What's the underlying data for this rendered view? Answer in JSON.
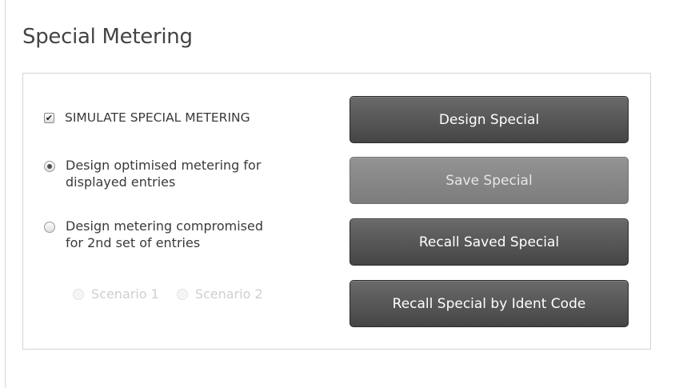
{
  "page": {
    "title": "Special Metering"
  },
  "options": {
    "simulate": {
      "label": "SIMULATE SPECIAL METERING",
      "checked": true
    },
    "optimised": {
      "line1": "Design optimised metering for",
      "line2": "displayed entries",
      "selected": true
    },
    "compromised": {
      "line1": "Design metering compromised",
      "line2": "for 2nd set of entries",
      "selected": false
    }
  },
  "scenarios": [
    {
      "label": "Scenario 1",
      "enabled": false
    },
    {
      "label": "Scenario 2",
      "enabled": false
    }
  ],
  "buttons": {
    "design": {
      "label": "Design Special",
      "enabled": true
    },
    "save": {
      "label": "Save Special",
      "enabled": false
    },
    "recall": {
      "label": "Recall Saved Special",
      "enabled": true
    },
    "ident": {
      "label": "Recall Special by Ident Code",
      "enabled": true
    }
  },
  "colors": {
    "button": "#555555",
    "button_disabled": "#888888",
    "panel_border": "#d4d4d4",
    "title": "#444444"
  }
}
